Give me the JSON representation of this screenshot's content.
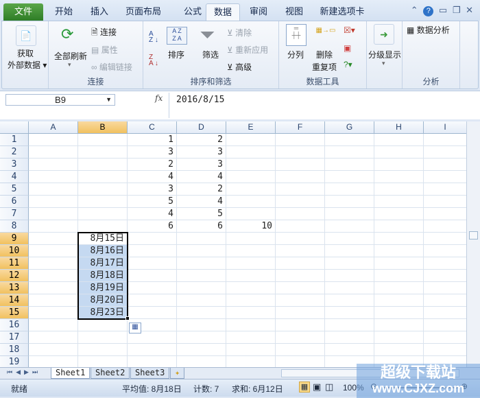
{
  "tabs": [
    "文件",
    "开始",
    "插入",
    "页面布局",
    "公式",
    "数据",
    "审阅",
    "视图",
    "新建选项卡"
  ],
  "active_tab": "数据",
  "ribbon": {
    "get_external": [
      "获取",
      "外部数据"
    ],
    "refresh_all": "全部刷新",
    "connections": "连接",
    "properties": "属性",
    "edit_links": "编辑链接",
    "group_connections": "连接",
    "sort": "排序",
    "filter": "筛选",
    "clear": "清除",
    "reapply": "重新应用",
    "advanced": "高级",
    "group_sort": "排序和筛选",
    "text_to_columns": "分列",
    "remove_dup": [
      "删除",
      "重复项"
    ],
    "group_tools": "数据工具",
    "outline": "分级显示",
    "data_analysis": "数据分析",
    "group_analysis": "分析"
  },
  "namebox": "B9",
  "fx": "fx",
  "formula": "2016/8/15",
  "columns": [
    "A",
    "B",
    "C",
    "D",
    "E",
    "F",
    "G",
    "H",
    "I"
  ],
  "rows": [
    "1",
    "2",
    "3",
    "4",
    "5",
    "6",
    "7",
    "8",
    "9",
    "10",
    "11",
    "12",
    "13",
    "14",
    "15",
    "16",
    "17",
    "18",
    "19"
  ],
  "cells": {
    "C": [
      "1",
      "3",
      "2",
      "4",
      "3",
      "5",
      "4",
      "6"
    ],
    "D": [
      "2",
      "3",
      "3",
      "4",
      "2",
      "4",
      "5",
      "6"
    ],
    "E8": "10",
    "B9_15": [
      "8月15日",
      "8月16日",
      "8月17日",
      "8月18日",
      "8月19日",
      "8月20日",
      "8月23日"
    ]
  },
  "sheets": [
    "Sheet1",
    "Sheet2",
    "Sheet3"
  ],
  "status": {
    "ready": "就绪",
    "avg": "平均值: 8月18日",
    "count": "计数: 7",
    "sum": "求和: 6月12日",
    "zoom": "100%"
  },
  "watermark": [
    "超级下载站",
    "www.CJXZ.com"
  ]
}
